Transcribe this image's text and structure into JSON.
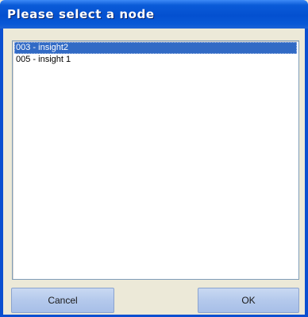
{
  "window": {
    "title": "Please select a node"
  },
  "node_list": {
    "items": [
      {
        "label": "003 - insight2",
        "selected": true
      },
      {
        "label": "005 - insight 1",
        "selected": false
      }
    ]
  },
  "buttons": {
    "cancel_label": "Cancel",
    "ok_label": "OK"
  },
  "colors": {
    "titlebar": "#0450d0",
    "selection": "#316ac5",
    "button": "#b4c9ec",
    "dialog_bg": "#ece9d8"
  }
}
